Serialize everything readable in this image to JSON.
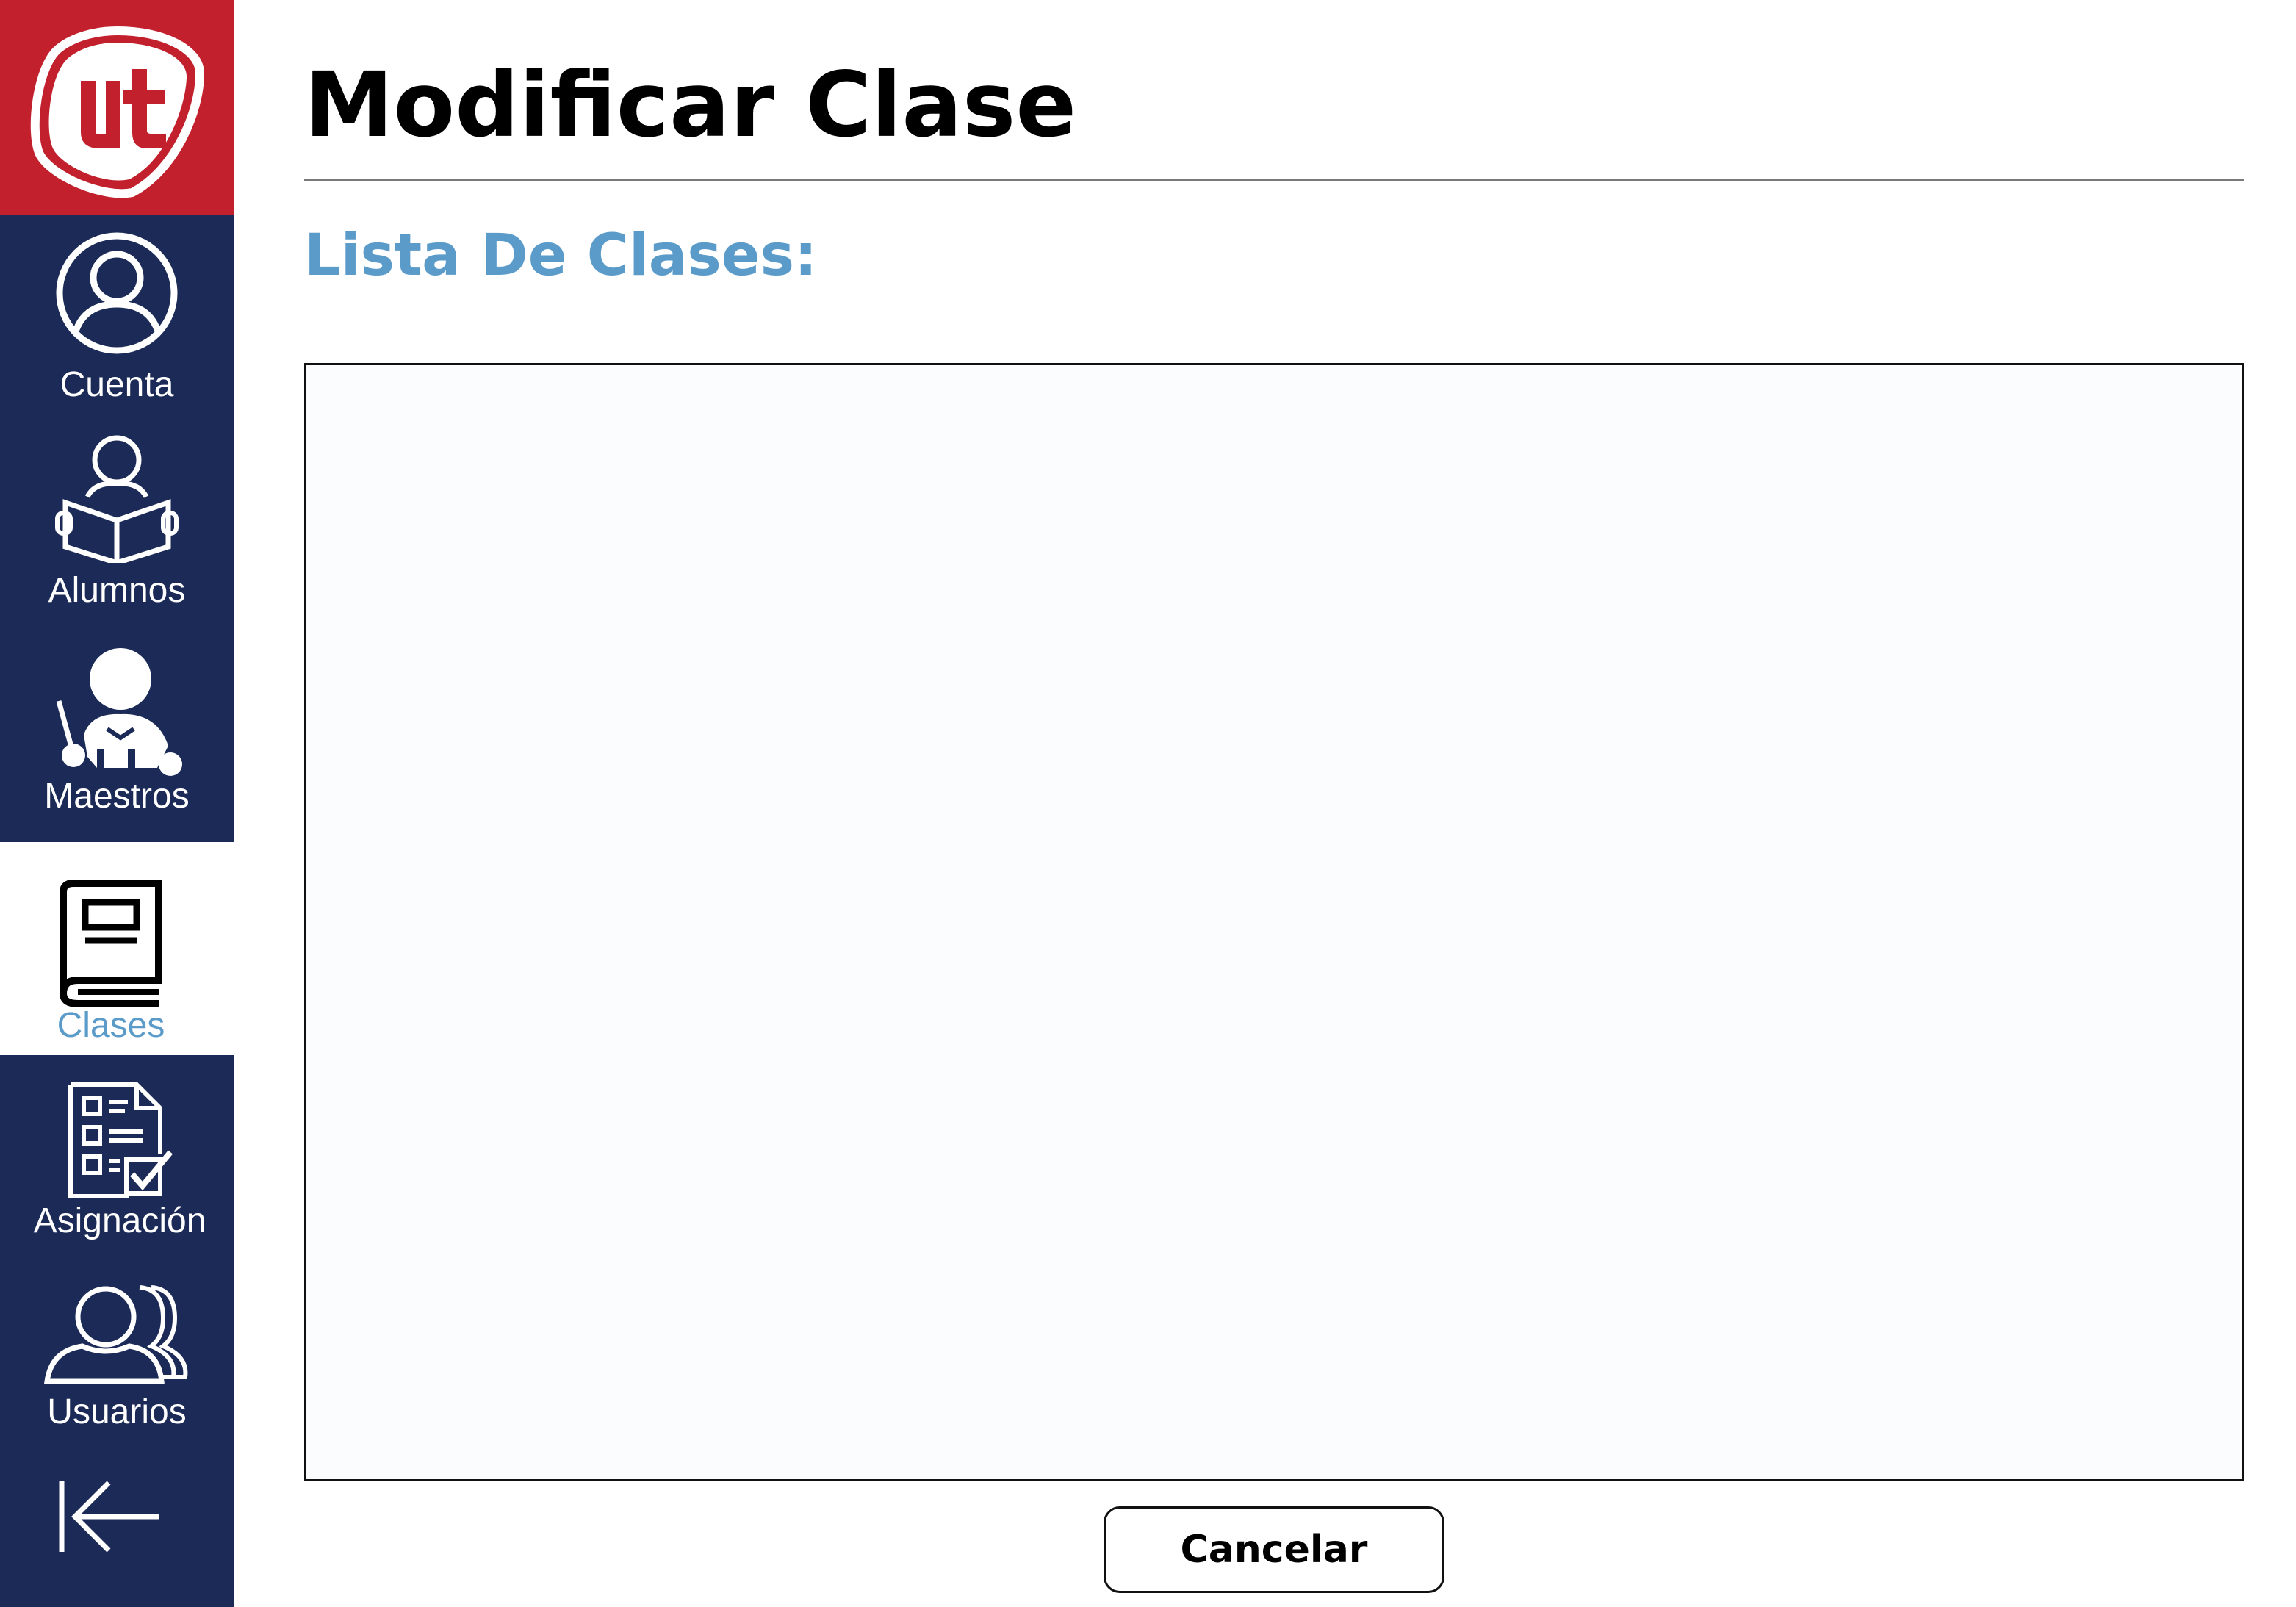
{
  "sidebar": {
    "logo_icon": "ut-logo",
    "items": [
      {
        "label": "Cuenta",
        "icon": "user-circle-icon",
        "active": false
      },
      {
        "label": "Alumnos",
        "icon": "student-reading-icon",
        "active": false
      },
      {
        "label": "Maestros",
        "icon": "teacher-icon",
        "active": false
      },
      {
        "label": "Clases",
        "icon": "book-icon",
        "active": true
      },
      {
        "label": "Asignación",
        "icon": "checklist-icon",
        "active": false
      },
      {
        "label": "Usuarios",
        "icon": "users-icon",
        "active": false
      }
    ],
    "logout_icon": "arrow-left-to-bar-icon"
  },
  "page": {
    "title": "Modificar Clase",
    "subtitle": "Lista De Clases:"
  },
  "class_list": {
    "items": []
  },
  "actions": {
    "cancel_label": "Cancelar"
  },
  "colors": {
    "sidebar_bg": "#1b2a56",
    "logo_bg": "#c2202c",
    "accent": "#5b9bc9",
    "active_nav_bg": "#ffffff"
  }
}
